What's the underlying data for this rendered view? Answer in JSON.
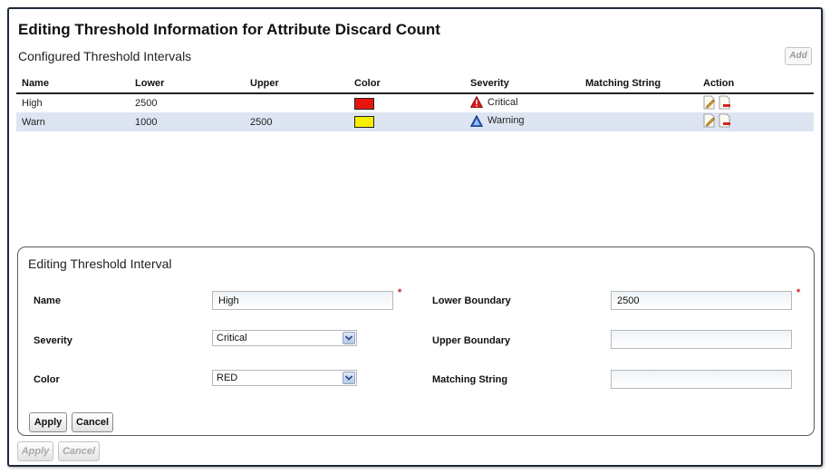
{
  "dialog": {
    "title": "Editing Threshold Information for Attribute Discard Count",
    "section_title": "Configured Threshold Intervals",
    "add_label": "Add"
  },
  "table": {
    "headers": [
      "Name",
      "Lower",
      "Upper",
      "Color",
      "Severity",
      "Matching String",
      "Action"
    ],
    "rows": [
      {
        "name": "High",
        "lower": "2500",
        "upper": "",
        "color": "#e8150f",
        "severity": "Critical",
        "severity_icon": "critical-triangle-icon",
        "matching": ""
      },
      {
        "name": "Warn",
        "lower": "1000",
        "upper": "2500",
        "color": "#f7ef00",
        "severity": "Warning",
        "severity_icon": "warning-triangle-icon",
        "matching": ""
      }
    ]
  },
  "editor": {
    "title": "Editing Threshold Interval",
    "name_label": "Name",
    "name_value": "High",
    "severity_label": "Severity",
    "severity_value": "Critical",
    "color_label": "Color",
    "color_value": "RED",
    "lower_label": "Lower Boundary",
    "lower_value": "2500",
    "upper_label": "Upper Boundary",
    "upper_value": "",
    "matching_label": "Matching String",
    "matching_value": "",
    "required_mark": "*",
    "apply_label": "Apply",
    "cancel_label": "Cancel"
  },
  "footer": {
    "apply_label": "Apply",
    "cancel_label": "Cancel"
  },
  "colors": {
    "critical": "#d41a1a",
    "warning": "#2a5fc4",
    "alt_row": "#dde4f2"
  }
}
